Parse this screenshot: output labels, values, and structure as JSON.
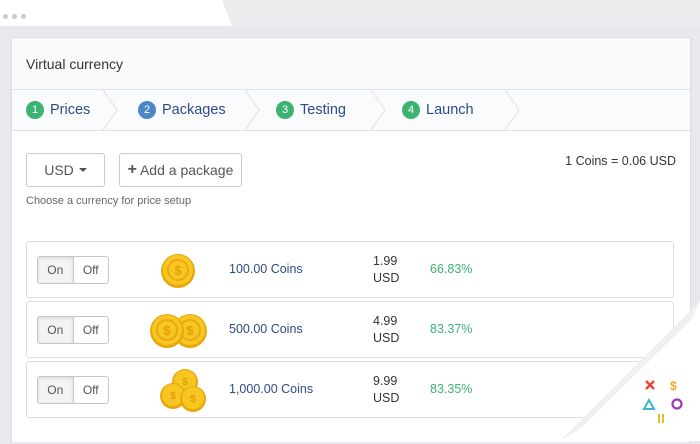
{
  "window": {
    "title": "Virtual currency"
  },
  "steps": [
    {
      "number": "1",
      "label": "Prices",
      "color": "#3cb371"
    },
    {
      "number": "2",
      "label": "Packages",
      "color": "#4a86c8"
    },
    {
      "number": "3",
      "label": "Testing",
      "color": "#3cb371"
    },
    {
      "number": "4",
      "label": "Launch",
      "color": "#3cb371"
    }
  ],
  "toolbar": {
    "currency_label": "USD",
    "add_label": "Add a package",
    "hint": "Choose a currency for price setup",
    "rate": "1 Coins = 0.06 USD"
  },
  "packages": [
    {
      "on": "On",
      "off": "Off",
      "icon": "single-coin-icon",
      "amount": "100.00 Coins",
      "price": "1.99",
      "currency": "USD",
      "percent": "66.83%"
    },
    {
      "on": "On",
      "off": "Off",
      "icon": "double-coin-icon",
      "amount": "500.00 Coins",
      "price": "4.99",
      "currency": "USD",
      "percent": "83.37%"
    },
    {
      "on": "On",
      "off": "Off",
      "icon": "coin-stack-icon",
      "amount": "1,000.00 Coins",
      "price": "9.99",
      "currency": "USD",
      "percent": "83.35%"
    }
  ],
  "colors": {
    "accent": "#2e4a8a",
    "success": "#3cb371",
    "coin": "#f5c518"
  }
}
